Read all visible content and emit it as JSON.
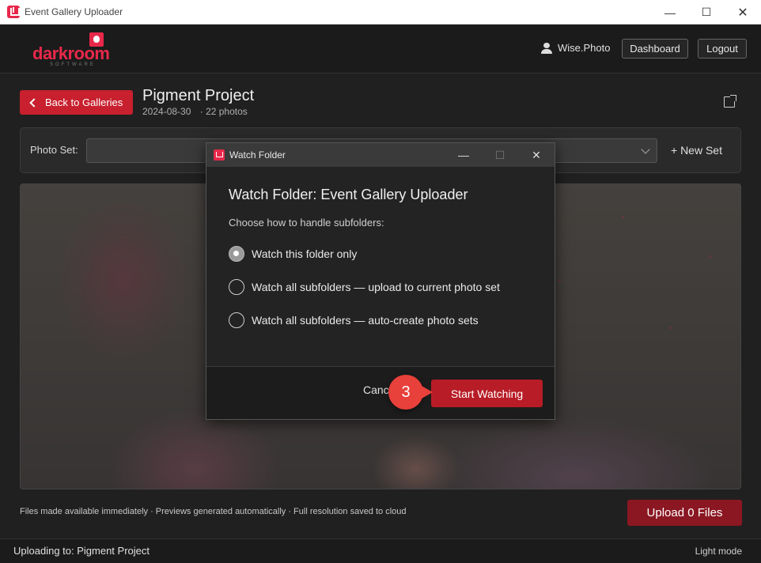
{
  "window": {
    "title": "Event Gallery Uploader",
    "controls": [
      "minimize",
      "maximize",
      "close"
    ]
  },
  "header": {
    "logo_text": "darkroom",
    "logo_sub": "SOFTWARE",
    "user_name": "Wise.Photo",
    "dashboard_label": "Dashboard",
    "logout_label": "Logout"
  },
  "gallery": {
    "back_label": "Back to Galleries",
    "title": "Pigment Project",
    "date": "2024-08-30",
    "photo_count": "· 22 photos"
  },
  "photo_set": {
    "label": "Photo Set:",
    "selected": "",
    "new_set_label": "+ New Set"
  },
  "footer": {
    "hint": "Files made available immediately · Previews generated automatically · Full resolution saved to cloud",
    "upload_label": "Upload 0 Files"
  },
  "statusbar": {
    "uploading_to": "Uploading to: Pigment Project",
    "theme_toggle": "Light mode"
  },
  "dialog": {
    "window_title": "Watch Folder",
    "heading": "Watch Folder: Event Gallery Uploader",
    "subheading": "Choose how to handle subfolders:",
    "options": [
      {
        "label": "Watch this folder only",
        "checked": true
      },
      {
        "label": "Watch all subfolders — upload to current photo set",
        "checked": false
      },
      {
        "label": "Watch all subfolders — auto-create photo sets",
        "checked": false
      }
    ],
    "cancel_label": "Cancel",
    "start_label": "Start Watching"
  },
  "annotation": {
    "step_number": "3"
  },
  "colors": {
    "accent_red": "#c8202e",
    "upload_red": "#8a1722",
    "badge_red": "#e8403a",
    "brand": "#e8284a"
  }
}
